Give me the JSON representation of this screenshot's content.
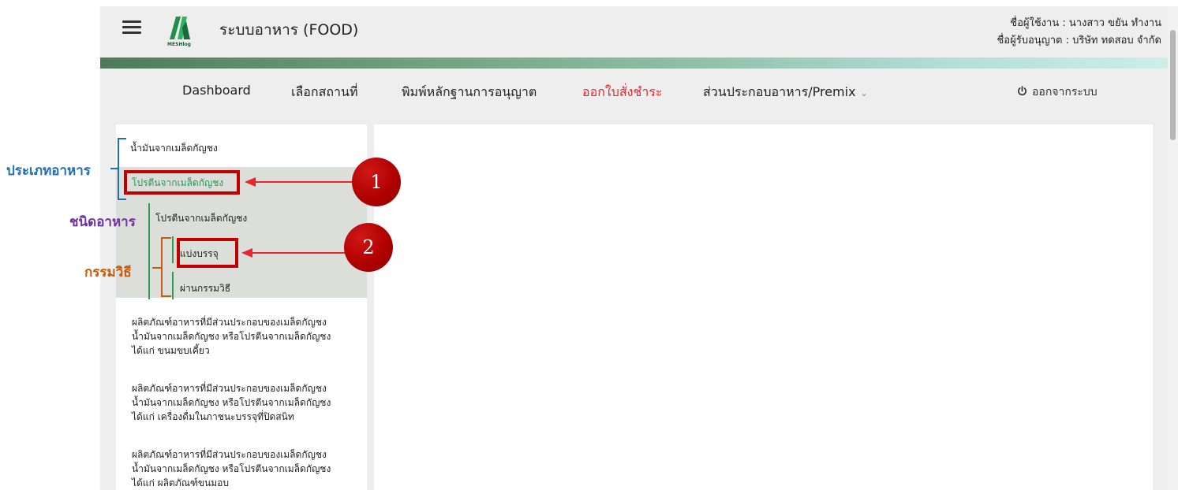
{
  "header": {
    "logo_text": "MESHlog",
    "app_title": "ระบบอาหาร (FOOD)",
    "user_line": "ชื่อผู้ใช้งาน : นางสาว ขยัน ทำงาน",
    "licensee_line": "ชื่อผู้รับอนุญาต : บริษัท ทดสอบ จำกัด"
  },
  "nav": {
    "items": [
      {
        "label": "Dashboard"
      },
      {
        "label": "เลือกสถานที่"
      },
      {
        "label": "พิมพ์หลักฐานการอนุญาต"
      },
      {
        "label": "ออกใบสั่งชำระ",
        "active": true
      },
      {
        "label": "ส่วนประกอบอาหาร/Premix"
      }
    ],
    "logout_label": "ออกจากระบบ"
  },
  "sidebar": {
    "food_category_1": "น้ำมันจากเมล็ดกัญชง",
    "food_category_2_selected": "โปรตีนจากเมล็ดกัญชง",
    "food_kind": "โปรตีนจากเมล็ดกัญชง",
    "process_1_selected": "แบ่งบรรจุ",
    "process_2": "ผ่านกรรมวิธี",
    "products": [
      {
        "line1": "ผลิตภัณฑ์อาหารที่มีส่วนประกอบของเมล็ดกัญชง",
        "line2": "น้ำมันจากเมล็ดกัญชง หรือโปรตีนจากเมล็ดกัญชง",
        "line3": "ได้แก่ ขนมขบเคี้ยว"
      },
      {
        "line1": "ผลิตภัณฑ์อาหารที่มีส่วนประกอบของเมล็ดกัญชง",
        "line2": "น้ำมันจากเมล็ดกัญชง หรือโปรตีนจากเมล็ดกัญชง",
        "line3": "ได้แก่ เครื่องดื่มในภาชนะบรรจุที่ปิดสนิท"
      },
      {
        "line1": "ผลิตภัณฑ์อาหารที่มีส่วนประกอบของเมล็ดกัญชง",
        "line2": "น้ำมันจากเมล็ดกัญชง หรือโปรตีนจากเมล็ดกัญชง",
        "line3": "ได้แก่ ผลิตภัณฑ์ขนมอบ"
      }
    ]
  },
  "annotations": {
    "food_type_label": "ประเภทอาหาร",
    "food_kind_label": "ชนิดอาหาร",
    "process_label": "กรรมวิธี",
    "step_1": "1",
    "step_2": "2"
  },
  "colors": {
    "active_nav": "#e8262d",
    "selected_item": "#1e9e55",
    "annotation_red": "#c00000",
    "food_type_blue": "#1f6fb5",
    "food_kind_purple": "#7030a0",
    "process_orange": "#c55a11",
    "kind_bracket_green": "#2e9e54"
  },
  "icons": [
    "menu-icon",
    "meshlog-logo",
    "power-icon",
    "chevron-down-icon"
  ]
}
